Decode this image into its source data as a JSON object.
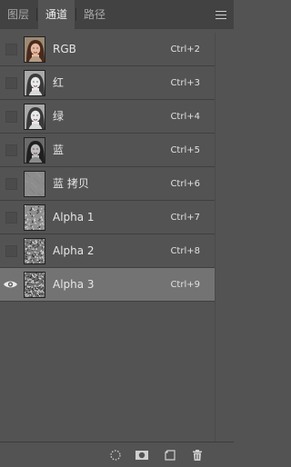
{
  "tabs": [
    {
      "label": "图层",
      "active": false
    },
    {
      "label": "通道",
      "active": true
    },
    {
      "label": "路径",
      "active": false
    }
  ],
  "menu_icon": "panel-menu-icon",
  "channels": [
    {
      "name": "RGB",
      "shortcut": "Ctrl+2",
      "thumb": "color-portrait",
      "visible": false,
      "selected": false
    },
    {
      "name": "红",
      "shortcut": "Ctrl+3",
      "thumb": "gray-portrait",
      "visible": false,
      "selected": false
    },
    {
      "name": "绿",
      "shortcut": "Ctrl+4",
      "thumb": "gray-portrait",
      "visible": false,
      "selected": false
    },
    {
      "name": "蓝",
      "shortcut": "Ctrl+5",
      "thumb": "dark-portrait",
      "visible": false,
      "selected": false
    },
    {
      "name": "蓝 拷贝",
      "shortcut": "Ctrl+6",
      "thumb": "flat-gray",
      "visible": false,
      "selected": false
    },
    {
      "name": "Alpha 1",
      "shortcut": "Ctrl+7",
      "thumb": "noise-light",
      "visible": false,
      "selected": false
    },
    {
      "name": "Alpha 2",
      "shortcut": "Ctrl+8",
      "thumb": "noise-medium",
      "visible": false,
      "selected": false
    },
    {
      "name": "Alpha 3",
      "shortcut": "Ctrl+9",
      "thumb": "noise-dense",
      "visible": true,
      "selected": true
    }
  ],
  "bottom_icons": [
    "load-selection-icon",
    "save-selection-mask-icon",
    "new-channel-icon",
    "delete-channel-icon"
  ],
  "colors": {
    "panel": "#535353",
    "tabbar": "#424242",
    "selected_row": "#737373",
    "text": "#e6e6e6"
  }
}
